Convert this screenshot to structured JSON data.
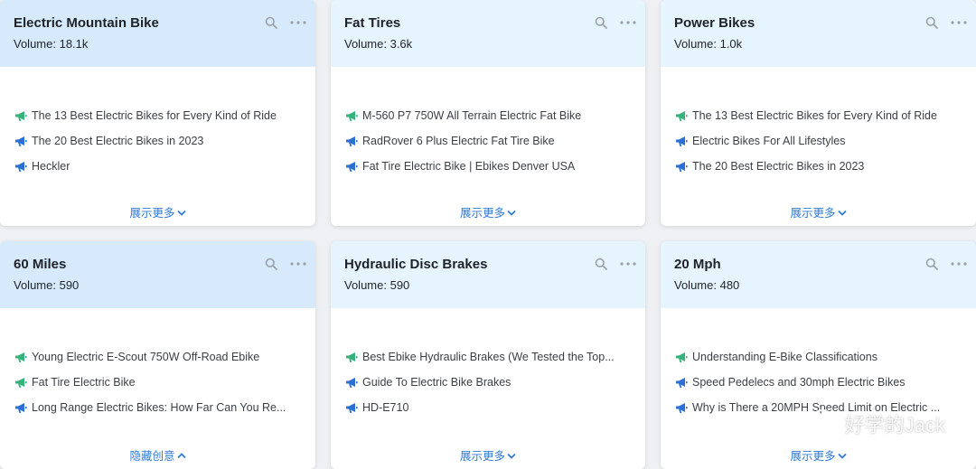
{
  "cards": [
    {
      "title": "Electric Mountain Bike",
      "volume": "Volume: 18.1k",
      "items": [
        {
          "icon": "megaphone-green-icon",
          "text": "The 13 Best Electric Bikes for Every Kind of Ride"
        },
        {
          "icon": "megaphone-blue-icon",
          "text": "The 20 Best Electric Bikes in 2023"
        },
        {
          "icon": "megaphone-blue-icon",
          "text": "Heckler"
        }
      ],
      "more_label": "展示更多",
      "more_dir": "down"
    },
    {
      "title": "Fat Tires",
      "volume": "Volume: 3.6k",
      "items": [
        {
          "icon": "megaphone-green-icon",
          "text": "M-560 P7 750W All Terrain Electric Fat Bike"
        },
        {
          "icon": "megaphone-blue-icon",
          "text": "RadRover 6 Plus Electric Fat Tire Bike"
        },
        {
          "icon": "megaphone-blue-icon",
          "text": "Fat Tire Electric Bike | Ebikes Denver USA"
        }
      ],
      "more_label": "展示更多",
      "more_dir": "down"
    },
    {
      "title": "Power Bikes",
      "volume": "Volume: 1.0k",
      "items": [
        {
          "icon": "megaphone-green-icon",
          "text": "The 13 Best Electric Bikes for Every Kind of Ride"
        },
        {
          "icon": "megaphone-blue-icon",
          "text": "Electric Bikes For All Lifestyles"
        },
        {
          "icon": "megaphone-blue-icon",
          "text": "The 20 Best Electric Bikes in 2023"
        }
      ],
      "more_label": "展示更多",
      "more_dir": "down"
    },
    {
      "title": "60 Miles",
      "volume": "Volume: 590",
      "items": [
        {
          "icon": "megaphone-green-icon",
          "text": "Young Electric E-Scout 750W Off-Road Ebike"
        },
        {
          "icon": "megaphone-green-icon",
          "text": "Fat Tire Electric Bike"
        },
        {
          "icon": "megaphone-blue-icon",
          "text": "Long Range Electric Bikes: How Far Can You Re..."
        }
      ],
      "more_label": "隐藏创意",
      "more_dir": "up"
    },
    {
      "title": "Hydraulic Disc Brakes",
      "volume": "Volume: 590",
      "items": [
        {
          "icon": "megaphone-green-icon",
          "text": "Best Ebike Hydraulic Brakes (We Tested the Top..."
        },
        {
          "icon": "megaphone-blue-icon",
          "text": "Guide To Electric Bike Brakes"
        },
        {
          "icon": "megaphone-blue-icon",
          "text": "HD-E710"
        }
      ],
      "more_label": "展示更多",
      "more_dir": "down"
    },
    {
      "title": "20 Mph",
      "volume": "Volume: 480",
      "items": [
        {
          "icon": "megaphone-green-icon",
          "text": "Understanding E-Bike Classifications"
        },
        {
          "icon": "megaphone-blue-icon",
          "text": "Speed Pedelecs and 30mph Electric Bikes"
        },
        {
          "icon": "megaphone-blue-icon",
          "text": "Why is There a 20MPH Speed Limit on Electric ..."
        }
      ],
      "more_label": "展示更多",
      "more_dir": "down"
    }
  ],
  "watermark": {
    "text": "好学的Jack",
    "icon": "wechat-icon"
  },
  "colors": {
    "header_blue": "#d6eafc",
    "header_lightblue": "#e6f4fd",
    "link": "#2e7bd8",
    "green_icon": "#34b27a",
    "blue_icon": "#2a6fd1"
  }
}
